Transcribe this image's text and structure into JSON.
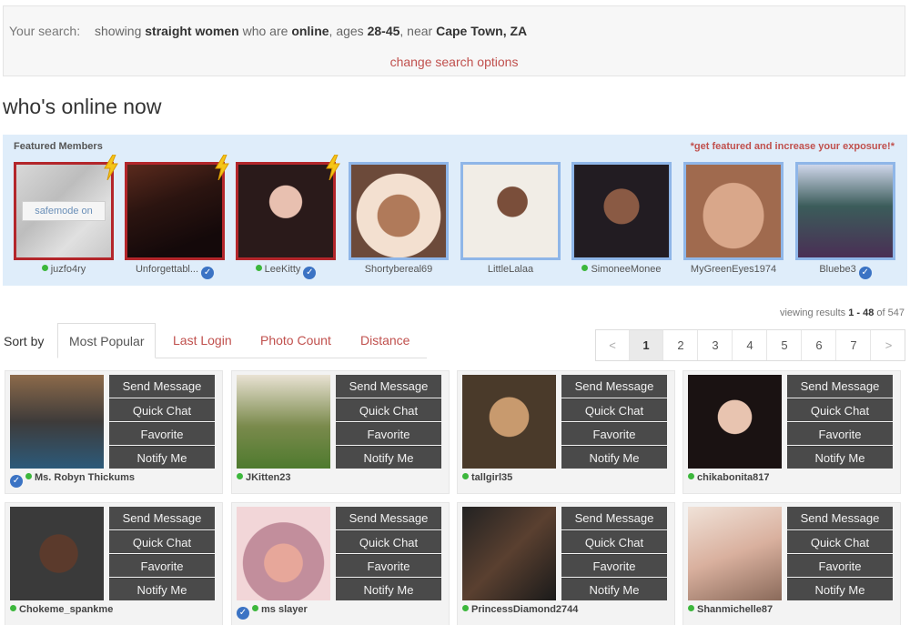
{
  "search": {
    "label": "Your search:",
    "prefix": "showing",
    "orientation": "straight women",
    "who_are": "who are",
    "status": "online",
    "ages_word": ", ages",
    "ages": "28-45",
    "near_word": ", near",
    "location": "Cape Town, ZA",
    "change_link": "change search options"
  },
  "heading": "who's online now",
  "featured": {
    "title": "Featured Members",
    "promo": "*get featured and increase your exposure!*",
    "safemode_label": "safemode on",
    "members": [
      {
        "name": "juzfo4ry",
        "online": true,
        "verified": false,
        "hot": true
      },
      {
        "name": "Unforgettabl...",
        "online": false,
        "verified": true,
        "hot": true
      },
      {
        "name": "LeeKitty",
        "online": true,
        "verified": true,
        "hot": true
      },
      {
        "name": "Shortybereal69",
        "online": false,
        "verified": false,
        "hot": false
      },
      {
        "name": "LittleLalaa",
        "online": false,
        "verified": false,
        "hot": false
      },
      {
        "name": "SimoneeMonee",
        "online": true,
        "verified": false,
        "hot": false
      },
      {
        "name": "MyGreenEyes1974",
        "online": false,
        "verified": false,
        "hot": false
      },
      {
        "name": "Bluebe3",
        "online": false,
        "verified": true,
        "hot": false
      }
    ]
  },
  "results": {
    "prefix": "viewing results",
    "range": "1 - 48",
    "of": "of",
    "total": "547"
  },
  "sort": {
    "label": "Sort by",
    "tabs": [
      "Most Popular",
      "Last Login",
      "Photo Count",
      "Distance"
    ],
    "active": "Most Popular"
  },
  "pager": {
    "prev": "<",
    "next": ">",
    "pages": [
      "1",
      "2",
      "3",
      "4",
      "5",
      "6",
      "7"
    ],
    "current": "1"
  },
  "actions": [
    "Send Message",
    "Quick Chat",
    "Favorite",
    "Notify Me"
  ],
  "check_glyph": "✓",
  "members": [
    {
      "name": "Ms. Robyn Thickums",
      "verified": true,
      "online": true
    },
    {
      "name": "JKitten23",
      "verified": false,
      "online": true
    },
    {
      "name": "tallgirl35",
      "verified": false,
      "online": true
    },
    {
      "name": "chikabonita817",
      "verified": false,
      "online": true
    },
    {
      "name": "Chokeme_spankme",
      "verified": false,
      "online": true
    },
    {
      "name": "ms slayer",
      "verified": true,
      "online": true
    },
    {
      "name": "PrincessDiamond2744",
      "verified": false,
      "online": true
    },
    {
      "name": "Shanmichelle87",
      "verified": false,
      "online": true
    }
  ]
}
